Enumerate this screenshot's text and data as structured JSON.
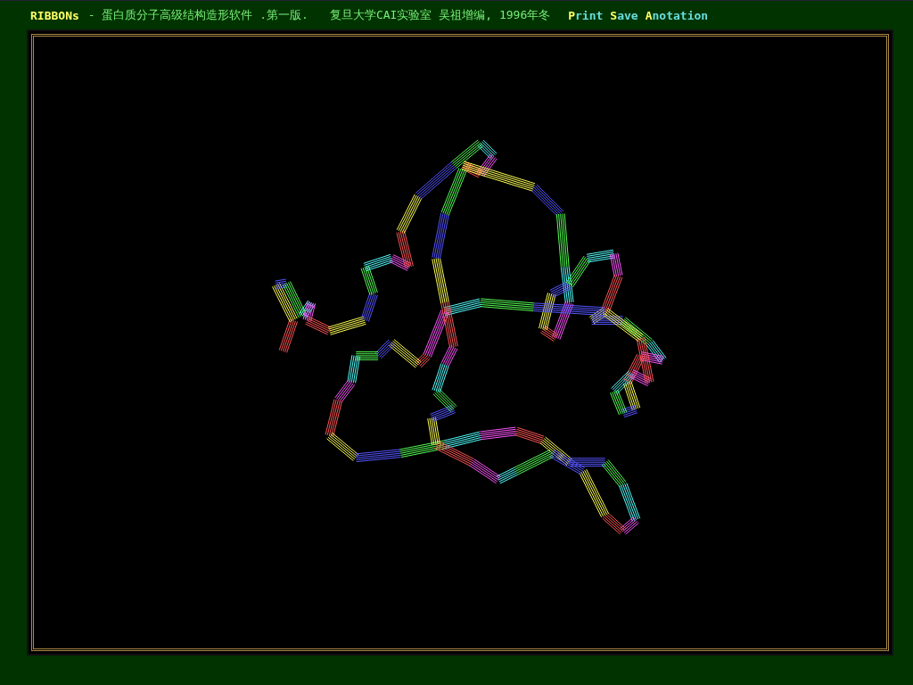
{
  "title_bar": {
    "segments": [
      {
        "kind": "program-name",
        "text": "RIBBONs"
      },
      {
        "kind": "subtitle",
        "text": "- 蛋白质分子高级结构造形软件 .第一版."
      },
      {
        "kind": "credit",
        "text": "复旦大学CAI实验室 吴祖增编, 1996年冬"
      }
    ],
    "menu": [
      "Print",
      "Save",
      "Anotation"
    ]
  }
}
